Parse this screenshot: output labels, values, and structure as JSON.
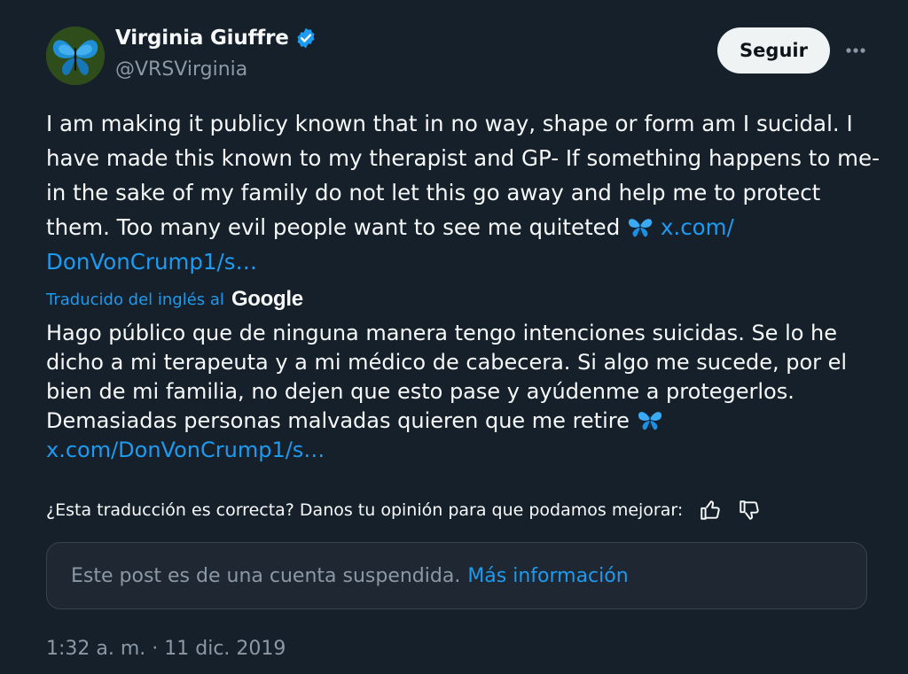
{
  "author": {
    "name": "Virginia Giuffre",
    "handle": "@VRSVirginia",
    "verified": true
  },
  "follow_label": "Seguir",
  "post": {
    "text": "I am making it publicy known that in no way, shape or form am I sucidal. I have made this known to my therapist and GP- If something happens to me- in the sake of my family do not let this go away and help me to protect them. Too many evil people want to see me quiteted",
    "emoji": "butterfly",
    "link": "x.com/\nDonVonCrump1/s…"
  },
  "translation": {
    "label": "Traducido del inglés al",
    "provider": "Google",
    "text": "Hago público que de ninguna manera tengo intenciones suicidas. Se lo he dicho a mi terapeuta y a mi médico de cabecera. Si algo me sucede, por el bien de mi familia, no dejen que esto pase y ayúdenme a protegerlos. Demasiadas personas malvadas quieren que me retire",
    "link": "x.com/DonVonCrump1/s…"
  },
  "feedback": {
    "question": "¿Esta traducción es correcta? Danos tu opinión para que podamos mejorar:"
  },
  "notice": {
    "text": "Este post es de una cuenta suspendida.",
    "link": "Más información"
  },
  "timestamp": "1:32 a. m. · 11 dic. 2019",
  "colors": {
    "background": "#15202b",
    "accent": "#1d9bf0",
    "muted": "#8b98a5",
    "text": "#f7f9f9"
  }
}
